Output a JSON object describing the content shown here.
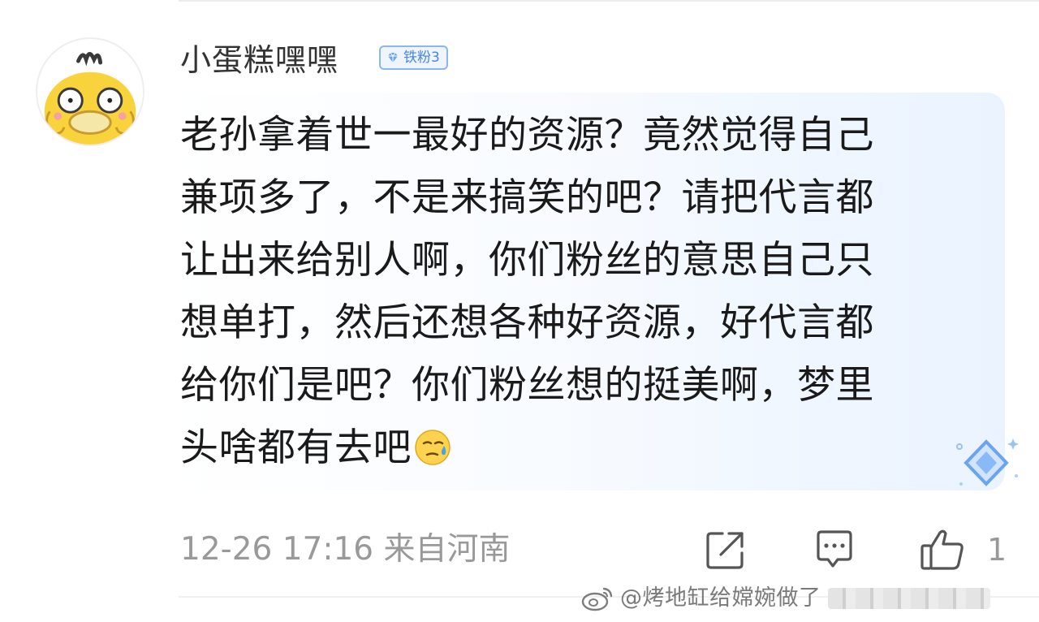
{
  "comment": {
    "username": "小蛋糕嘿嘿",
    "badge_label": "铁粉3",
    "lines": [
      "老孙拿着世一最好的资源？竟然觉得自己",
      "兼项多了，不是来搞笑的吧？请把代言都",
      "让出来给别人啊，你们粉丝的意思自己只",
      "想单打，然后还想各种好资源，好代言都",
      "给你们是吧？你们粉丝想的挺美啊，梦里",
      "头啥都有去吧"
    ],
    "emoji": "sweat-emoji",
    "timestamp": "12-26 17:16",
    "location": "来自河南",
    "footer_meta": "12-26 17:16 来自河南",
    "like_count": "1"
  },
  "watermark": {
    "text": "@烤地缸给嫦婉做了"
  },
  "icons": {
    "avatar": "psyduck-avatar",
    "badge": "diamond-badge-icon",
    "share": "share-icon",
    "comment": "comment-icon",
    "like": "thumbs-up-icon",
    "card_decoration": "diamond-decoration"
  },
  "colors": {
    "text": "#1a1a1a",
    "meta": "#999999",
    "badge_border": "#8bb6f0",
    "badge_text": "#4a86e0",
    "bubble_tint": "#eaf3ff"
  }
}
